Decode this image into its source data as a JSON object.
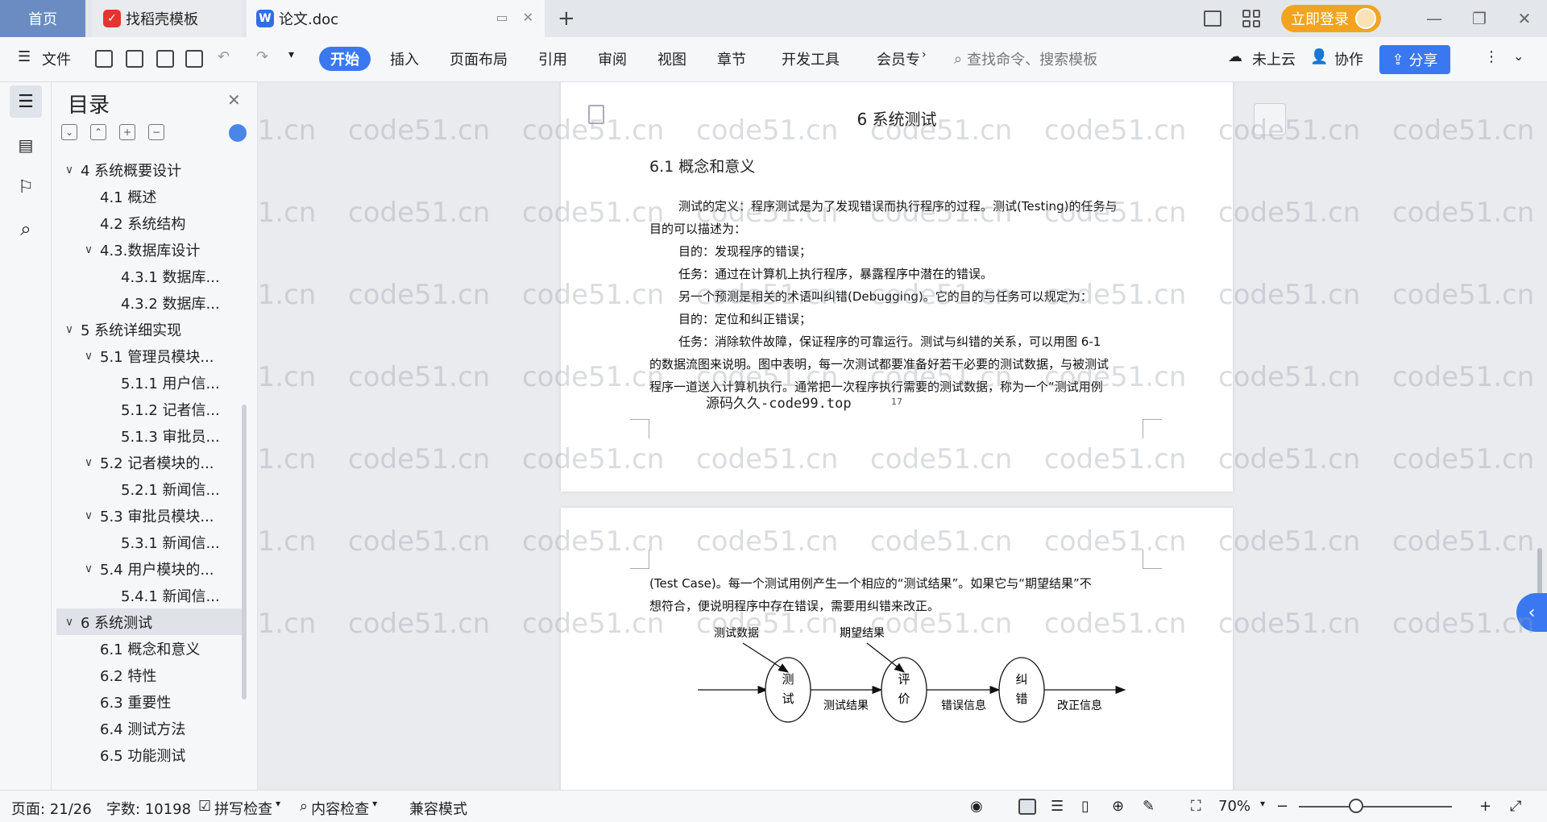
{
  "tabs": {
    "home": "首页",
    "daoke": "找稻壳模板",
    "doc": "论文.doc",
    "login": "立即登录"
  },
  "ribbon": {
    "file": "文件",
    "start": "开始",
    "insert": "插入",
    "layout": "页面布局",
    "reference": "引用",
    "review": "审阅",
    "view": "视图",
    "chapter": "章节",
    "devtools": "开发工具",
    "member": "会员专",
    "search_placeholder": "查找命令、搜索模板",
    "cloud": "未上云",
    "collab": "协作",
    "share": "分享"
  },
  "toc": {
    "title": "目录",
    "items": [
      {
        "label": "4 系统概要设计",
        "level": 1,
        "expanded": true
      },
      {
        "label": "4.1 概述",
        "level": 2
      },
      {
        "label": "4.2 系统结构",
        "level": 2
      },
      {
        "label": "4.3.数据库设计",
        "level": 2,
        "expanded": true
      },
      {
        "label": "4.3.1 数据库...",
        "level": 3
      },
      {
        "label": "4.3.2 数据库...",
        "level": 3
      },
      {
        "label": "5 系统详细实现",
        "level": 1,
        "expanded": true
      },
      {
        "label": "5.1 管理员模块...",
        "level": 2,
        "expanded": true
      },
      {
        "label": "5.1.1 用户信...",
        "level": 3
      },
      {
        "label": "5.1.2 记者信...",
        "level": 3
      },
      {
        "label": "5.1.3 审批员...",
        "level": 3
      },
      {
        "label": "5.2 记者模块的...",
        "level": 2,
        "expanded": true
      },
      {
        "label": "5.2.1 新闻信...",
        "level": 3
      },
      {
        "label": "5.3 审批员模块...",
        "level": 2,
        "expanded": true
      },
      {
        "label": "5.3.1 新闻信...",
        "level": 3
      },
      {
        "label": "5.4 用户模块的...",
        "level": 2,
        "expanded": true
      },
      {
        "label": "5.4.1 新闻信...",
        "level": 3
      },
      {
        "label": "6 系统测试",
        "level": 1,
        "expanded": true,
        "selected": true
      },
      {
        "label": "6.1 概念和意义",
        "level": 2
      },
      {
        "label": "6.2 特性",
        "level": 2
      },
      {
        "label": "6.3 重要性",
        "level": 2
      },
      {
        "label": "6.4 测试方法",
        "level": 2
      },
      {
        "label": "6.5 功能测试",
        "level": 2
      }
    ]
  },
  "document": {
    "chapter_title": "6 系统测试",
    "section_title": "6.1 概念和意义",
    "page1_paragraphs": [
      "测试的定义：程序测试是为了发现错误而执行程序的过程。测试(Testing)的任务与",
      "目的可以描述为：",
      "目的：发现程序的错误；",
      "任务：通过在计算机上执行程序，暴露程序中潜在的错误。",
      "另一个预测是相关的术语叫纠错(Debugging)。它的目的与任务可以规定为：",
      "目的：定位和纠正错误；",
      "任务：消除软件故障，保证程序的可靠运行。测试与纠错的关系，可以用图 6-1",
      "的数据流图来说明。图中表明，每一次测试都要准备好若干必要的测试数据，与被测试",
      "程序一道送入计算机执行。通常把一次程序执行需要的测试数据，称为一个“测试用例"
    ],
    "footer_text": "源码久久-code99.top",
    "page_number": "17",
    "page2_paragraphs": [
      "(Test Case)。每一个测试用例产生一个相应的“测试结果”。如果它与“期望结果”不",
      "想符合，便说明程序中存在错误，需要用纠错来改正。"
    ],
    "diagram": {
      "input_test_data": "测试数据",
      "input_expected": "期望结果",
      "node_test": [
        "测",
        "试"
      ],
      "node_eval": [
        "评",
        "价"
      ],
      "node_debug": [
        "纠",
        "错"
      ],
      "edge_test_result": "测试结果",
      "edge_error_info": "错误信息",
      "edge_fix_info": "改正信息"
    },
    "watermark": "code51.cn"
  },
  "statusbar": {
    "page": "页面: 21/26",
    "words": "字数: 10198",
    "spell": "拼写检查",
    "content_check": "内容检查",
    "compat": "兼容模式",
    "zoom": "70%"
  }
}
